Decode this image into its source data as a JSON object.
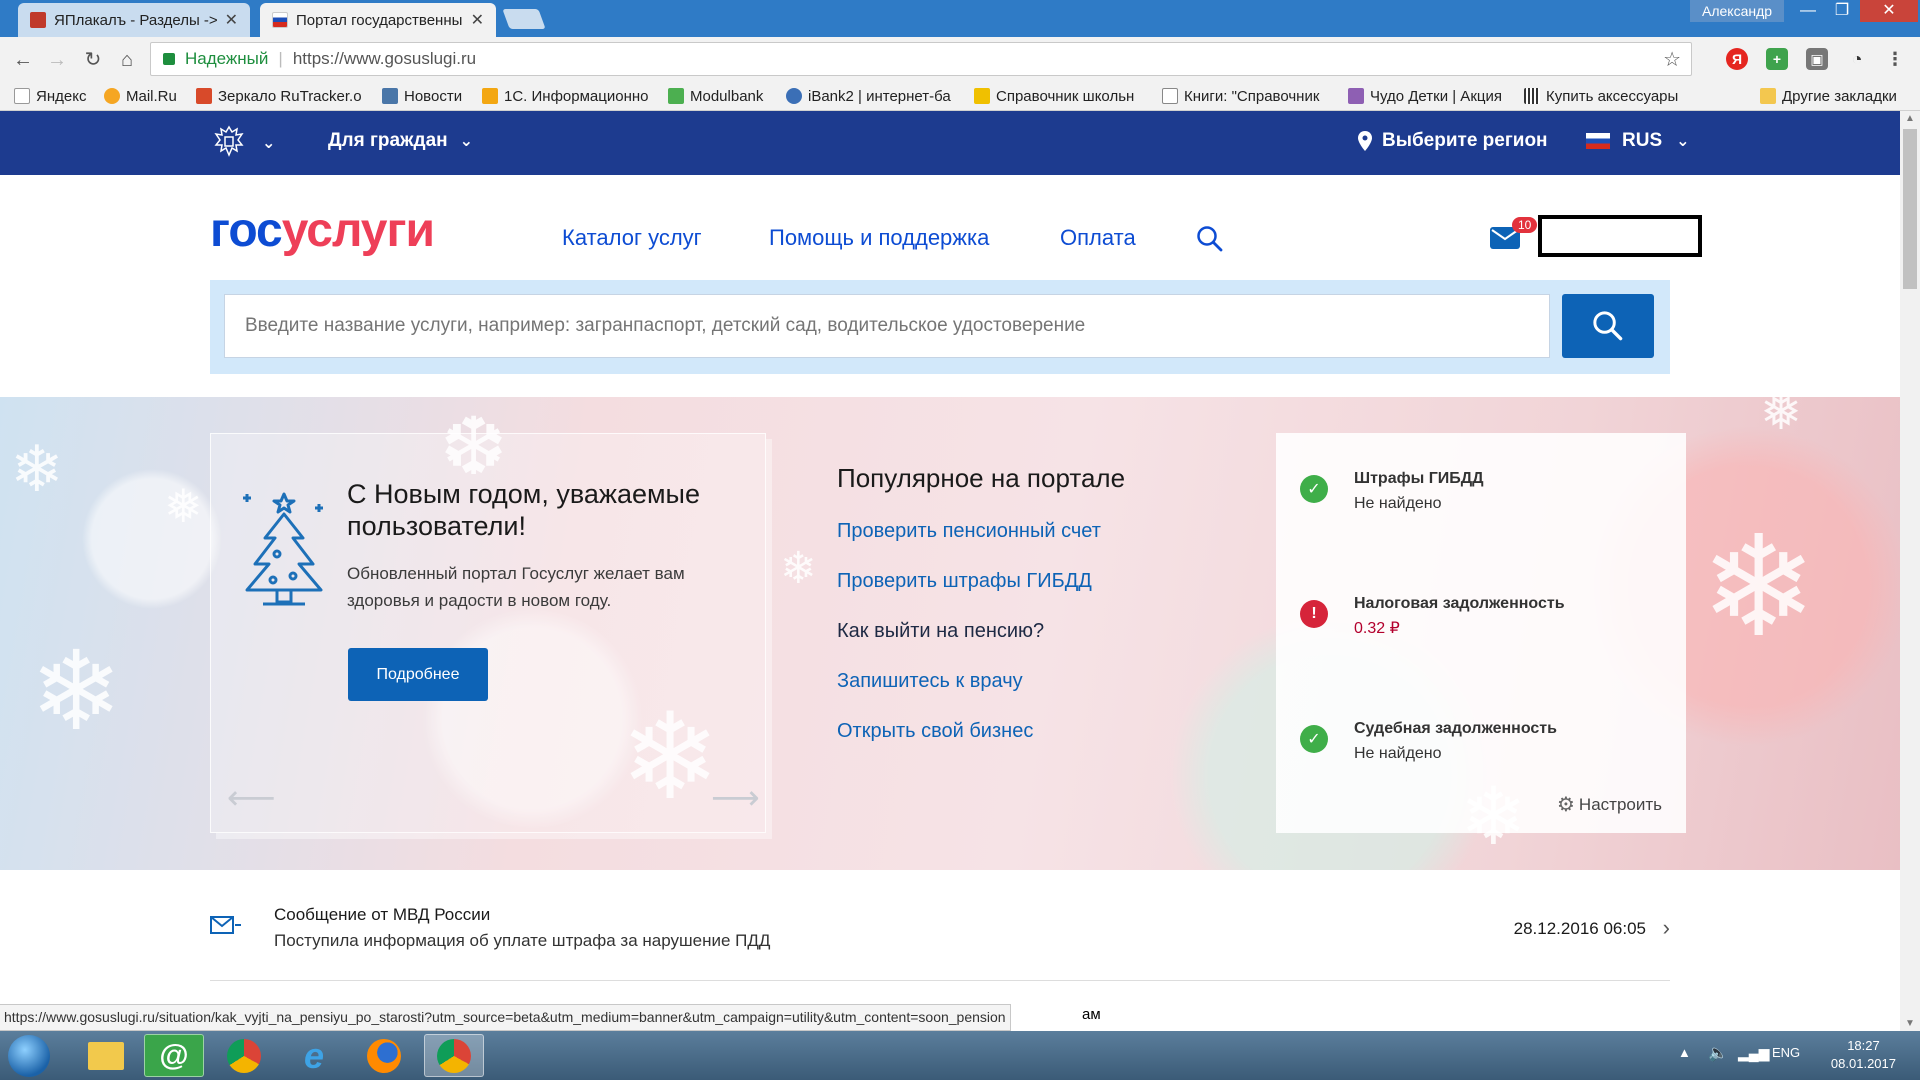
{
  "browser": {
    "tabs": [
      {
        "title": "ЯПлакалъ - Разделы ->",
        "active": false
      },
      {
        "title": "Портал государственны",
        "active": true
      }
    ],
    "profile": "Александр",
    "omnibox": {
      "secure_label": "Надежный",
      "url": "https://www.gosuslugi.ru"
    },
    "bookmarks": [
      {
        "label": "Яндекс",
        "icon": "yandex-icon",
        "color": "#e52620"
      },
      {
        "label": "Mail.Ru",
        "icon": "mailru-icon",
        "color": "#f5a623"
      },
      {
        "label": "Зеркало RuTracker.o",
        "icon": "rutracker-icon",
        "color": "#d84a2a"
      },
      {
        "label": "Новости",
        "icon": "vk-icon",
        "color": "#4a76a8"
      },
      {
        "label": "1С. Информационно",
        "icon": "1c-icon",
        "color": "#f3a712"
      },
      {
        "label": "Modulbank",
        "icon": "modulbank-icon",
        "color": "#4caf50"
      },
      {
        "label": "iBank2 | интернет-ба",
        "icon": "ibank-icon",
        "color": "#3b6fb6"
      },
      {
        "label": "Справочник школьн",
        "icon": "school-icon",
        "color": "#f0c000"
      },
      {
        "label": "Книги: \"Справочник",
        "icon": "page-icon",
        "color": "#888888"
      },
      {
        "label": "Чудо Детки | Акция",
        "icon": "chudo-icon",
        "color": "#8e5fb3"
      },
      {
        "label": "Купить аксессуары",
        "icon": "barcode-icon",
        "color": "#333333"
      },
      {
        "label": "Другие закладки",
        "icon": "folder-icon",
        "color": "#f3c74f"
      }
    ],
    "status_url": "https://www.gosuslugi.ru/situation/kak_vyjti_na_pensiyu_po_starosti?utm_source=beta&utm_medium=banner&utm_campaign=utility&utm_content=soon_pension",
    "status_tail": "ам"
  },
  "site": {
    "topnav": {
      "audience": "Для граждан",
      "region": "Выберите регион",
      "lang": "RUS"
    },
    "logo": {
      "part1": "гос",
      "part2": "услуги"
    },
    "menu": [
      "Каталог услуг",
      "Помощь и поддержка",
      "Оплата"
    ],
    "mail_badge": "10",
    "search_placeholder": "Введите название услуги, например: загранпаспорт, детский сад, водительское удостоверение",
    "promo": {
      "title": "С Новым годом, уважаемые пользователи!",
      "text": "Обновленный портал Госуслуг желает вам здоровья и радости в новом году.",
      "button": "Подробнее"
    },
    "popular": {
      "heading": "Популярное на портале",
      "links": [
        "Проверить пенсионный счет",
        "Проверить штрафы ГИБДД",
        "Как выйти на пенсию?",
        "Запишитесь к врачу",
        "Открыть свой бизнес"
      ]
    },
    "widget": {
      "items": [
        {
          "title": "Штрафы ГИБДД",
          "value": "Не найдено",
          "status": "ok"
        },
        {
          "title": "Налоговая задолженность",
          "value": "0.32 ₽",
          "status": "alert"
        },
        {
          "title": "Судебная задолженность",
          "value": "Не найдено",
          "status": "ok"
        }
      ],
      "settings": "Настроить"
    },
    "notice": {
      "title": "Сообщение от МВД России",
      "text": "Поступила информация об уплате штрафа за нарушение ПДД",
      "date": "28.12.2016 06:05"
    }
  },
  "taskbar": {
    "lang": "ENG",
    "time": "18:27",
    "date": "08.01.2017"
  },
  "colors": {
    "brand_blue": "#0d4cd3",
    "brand_red": "#ee3f58",
    "nav_bg": "#1d3b8f",
    "button_blue": "#0d63b6",
    "ok_green": "#3fae49",
    "alert_red": "#d6243a"
  }
}
